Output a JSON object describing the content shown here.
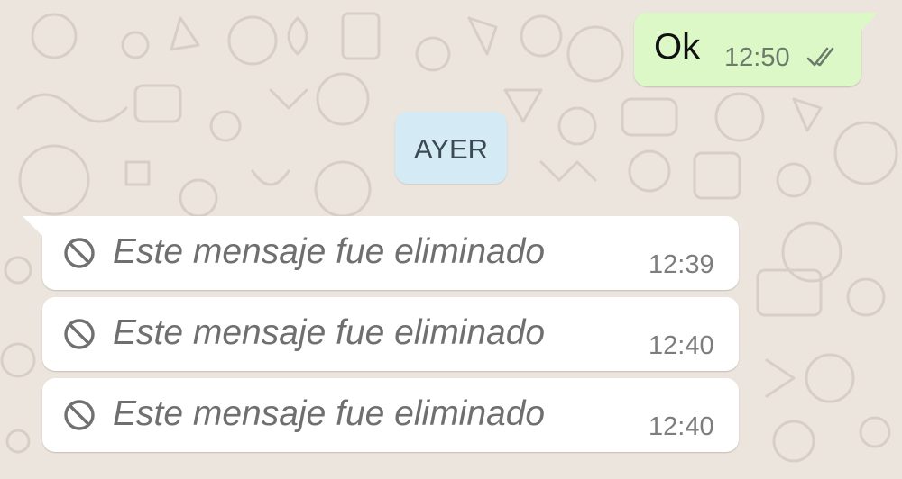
{
  "theme": {
    "wallpaper": "#ece5dd",
    "outgoing_bubble": "#dcf8c6",
    "incoming_bubble": "#ffffff",
    "date_chip": "#d4eaf4",
    "read_ticks_color": "#6b7a6b"
  },
  "outgoing_message": {
    "text": "Ok",
    "time": "12:50",
    "status_icon": "double-check-icon"
  },
  "date_divider": {
    "label": "AYER"
  },
  "deleted_messages": [
    {
      "icon": "deleted-icon",
      "text": "Este mensaje fue eliminado",
      "time": "12:39"
    },
    {
      "icon": "deleted-icon",
      "text": "Este mensaje fue eliminado",
      "time": "12:40"
    },
    {
      "icon": "deleted-icon",
      "text": "Este mensaje fue eliminado",
      "time": "12:40"
    }
  ]
}
